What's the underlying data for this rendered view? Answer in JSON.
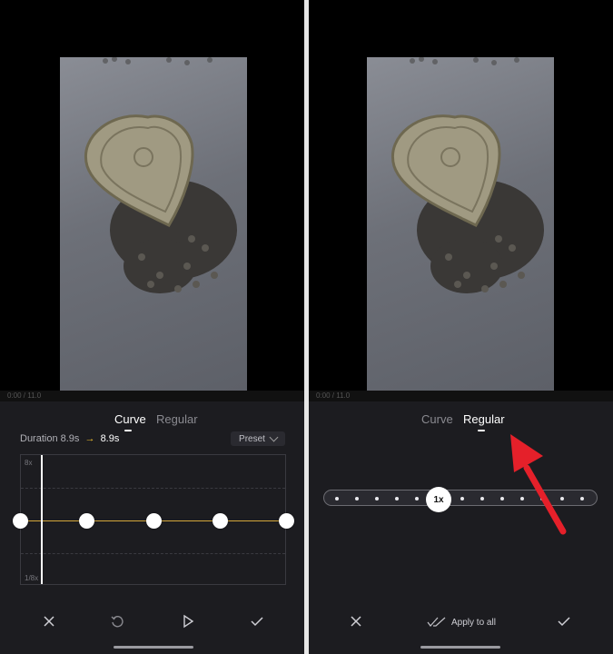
{
  "left_screen": {
    "tabs": [
      {
        "label": "Curve",
        "active": true
      },
      {
        "label": "Regular",
        "active": false
      }
    ],
    "duration_label": "Duration 8.9s",
    "duration_arrow": "→",
    "duration_new": "8.9s",
    "preset_label": "Preset",
    "graph": {
      "y_max_label": "8x",
      "y_min_label": "1/8x",
      "points": 5,
      "curve_level": "1x"
    },
    "actions": [
      "close-icon",
      "reset-icon",
      "play-icon",
      "check-icon"
    ]
  },
  "right_screen": {
    "tabs": [
      {
        "label": "Curve",
        "active": false
      },
      {
        "label": "Regular",
        "active": true
      }
    ],
    "speed_value": "1x",
    "apply_label": "Apply to all",
    "actions": [
      "close-icon",
      "apply-all-icon",
      "check-icon"
    ]
  },
  "colors": {
    "accent_yellow": "#f2c12e",
    "sheet_bg": "#1c1c20",
    "annotation_red": "#e5202a"
  }
}
